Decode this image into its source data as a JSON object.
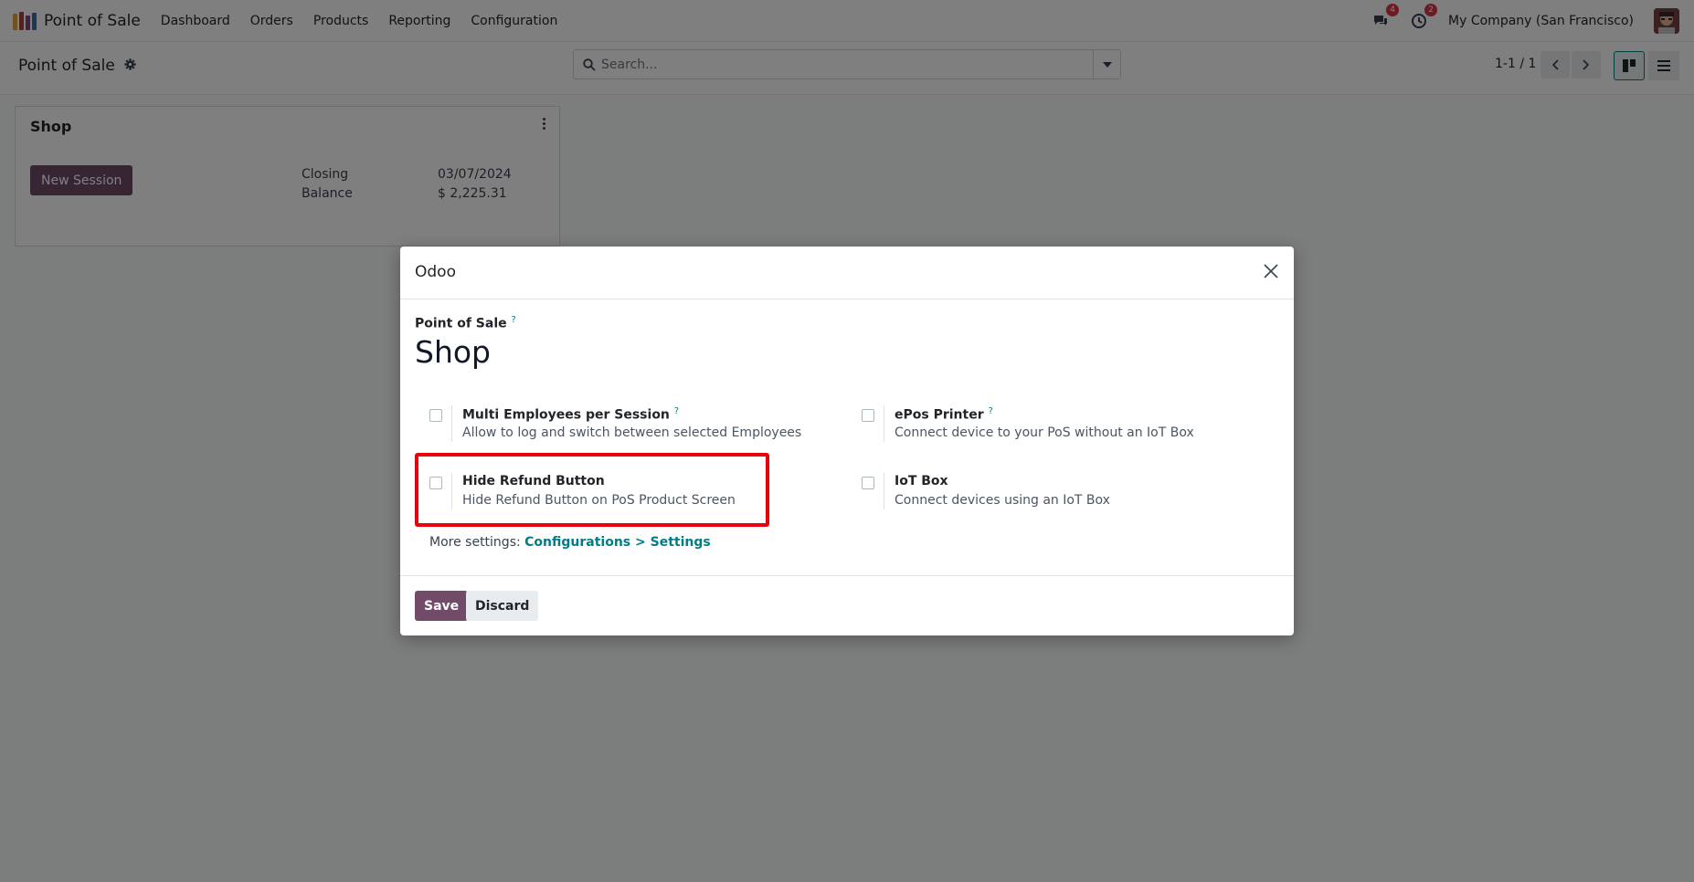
{
  "navbar": {
    "brand": "Point of Sale",
    "menu": [
      "Dashboard",
      "Orders",
      "Products",
      "Reporting",
      "Configuration"
    ],
    "messages_count": "4",
    "activities_count": "2",
    "company": "My Company (San Francisco)"
  },
  "control_panel": {
    "breadcrumb": "Point of Sale",
    "search_placeholder": "Search...",
    "pager": "1-1 / 1"
  },
  "card": {
    "title": "Shop",
    "new_session_label": "New Session",
    "closing_label": "Closing",
    "closing_value": "03/07/2024",
    "balance_label": "Balance",
    "balance_value": "$ 2,225.31"
  },
  "modal": {
    "title": "Odoo",
    "field_label": "Point of Sale",
    "help_mark": "?",
    "record_name": "Shop",
    "settings": [
      {
        "title": "Multi Employees per Session",
        "description": "Allow to log and switch between selected Employees",
        "has_help": true
      },
      {
        "title": "ePos Printer",
        "description": "Connect device to your PoS without an IoT Box",
        "has_help": true
      },
      {
        "title": "Hide Refund Button",
        "description": "Hide Refund Button on PoS Product Screen",
        "has_help": false
      },
      {
        "title": "IoT Box",
        "description": "Connect devices using an IoT Box",
        "has_help": false
      }
    ],
    "more_settings_label": "More settings:",
    "more_settings_link": "Configurations > Settings",
    "save_label": "Save",
    "discard_label": "Discard"
  },
  "colors": {
    "primary": "#714b67",
    "link": "#017e84",
    "highlight": "#e8000b",
    "badge": "#dc3545"
  }
}
